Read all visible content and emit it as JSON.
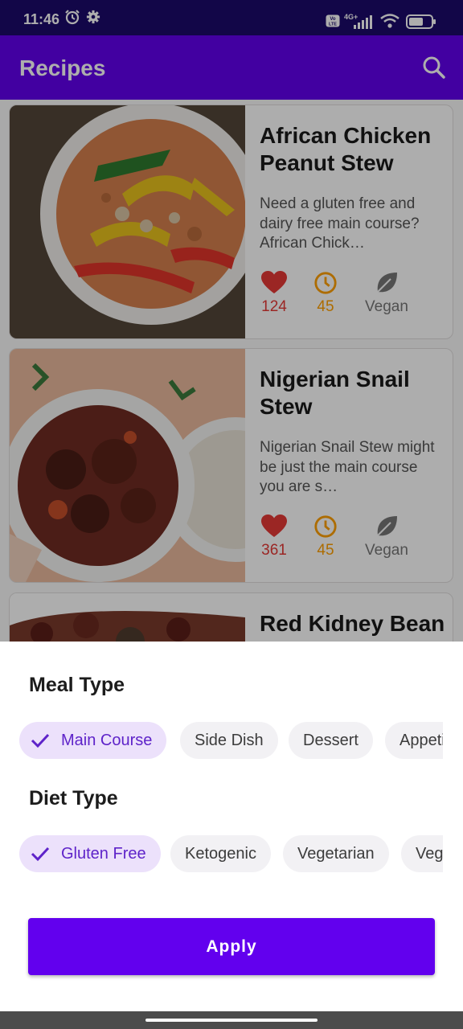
{
  "status_bar": {
    "time": "11:46",
    "icons": [
      "alarm-icon",
      "gear-icon",
      "volte-icon",
      "signal-icon",
      "wifi-icon",
      "battery-icon"
    ],
    "network_label": "4G+"
  },
  "app_bar": {
    "title": "Recipes",
    "search_icon": "search-icon",
    "color": "#6200ee"
  },
  "recipes": [
    {
      "title": "African Chicken Peanut Stew",
      "description": "Need a gluten free and dairy free main course? African Chick…",
      "likes": "124",
      "minutes": "45",
      "diet": "Vegan"
    },
    {
      "title": "Nigerian Snail Stew",
      "description": "Nigerian Snail Stew might be just the main course you are s…",
      "likes": "361",
      "minutes": "45",
      "diet": "Vegan"
    },
    {
      "title": "Red Kidney Bean",
      "description": "",
      "likes": "",
      "minutes": "",
      "diet": ""
    }
  ],
  "filter_sheet": {
    "meal_type_title": "Meal Type",
    "meal_types": [
      "Main Course",
      "Side Dish",
      "Dessert",
      "Appetizer"
    ],
    "meal_type_selected": "Main Course",
    "diet_type_title": "Diet Type",
    "diet_types": [
      "Gluten Free",
      "Ketogenic",
      "Vegetarian",
      "Vegan"
    ],
    "diet_type_selected": "Gluten Free",
    "apply_label": "Apply"
  },
  "colors": {
    "accent": "#6200ee",
    "likes": "#e53935",
    "time": "#ffa000",
    "vegan": "#777777",
    "chip_selected_bg": "#ece1fb"
  }
}
